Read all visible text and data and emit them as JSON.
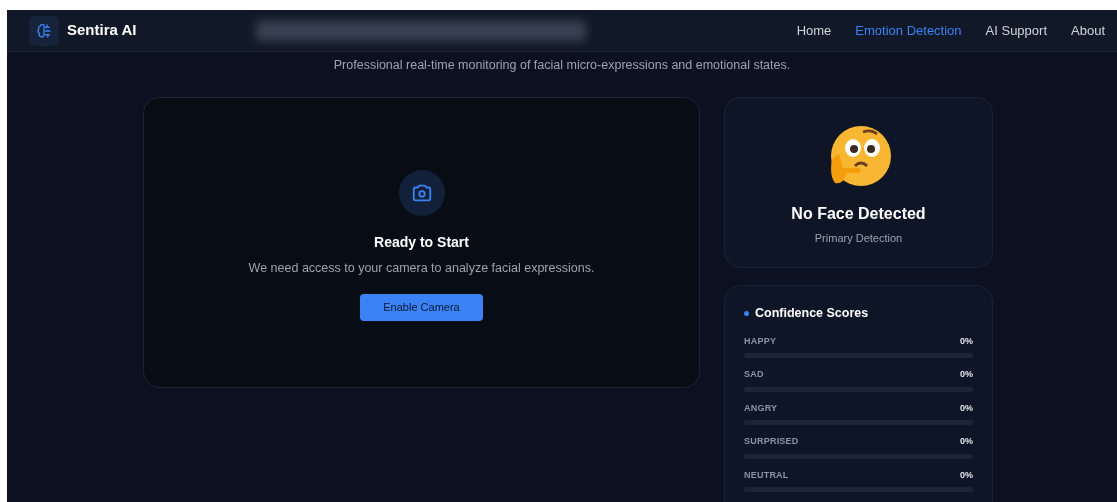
{
  "brand": {
    "name": "Sentira AI"
  },
  "nav": [
    {
      "label": "Home",
      "selected": false
    },
    {
      "label": "Emotion Detection",
      "selected": true
    },
    {
      "label": "AI Support",
      "selected": false
    },
    {
      "label": "About",
      "selected": false
    }
  ],
  "subtitle": "Professional real-time monitoring of facial micro-expressions and emotional states.",
  "camera_panel": {
    "title": "Ready to Start",
    "message": "We need access to your camera to analyze facial expressions.",
    "button": "Enable Camera"
  },
  "detection": {
    "title": "No Face Detected",
    "caption": "Primary Detection"
  },
  "confidence": {
    "title": "Confidence Scores",
    "scores": [
      {
        "label": "HAPPY",
        "reading": "0%"
      },
      {
        "label": "SAD",
        "reading": "0%"
      },
      {
        "label": "ANGRY",
        "reading": "0%"
      },
      {
        "label": "SURPRISED",
        "reading": "0%"
      },
      {
        "label": "NEUTRAL",
        "reading": "0%"
      }
    ]
  }
}
